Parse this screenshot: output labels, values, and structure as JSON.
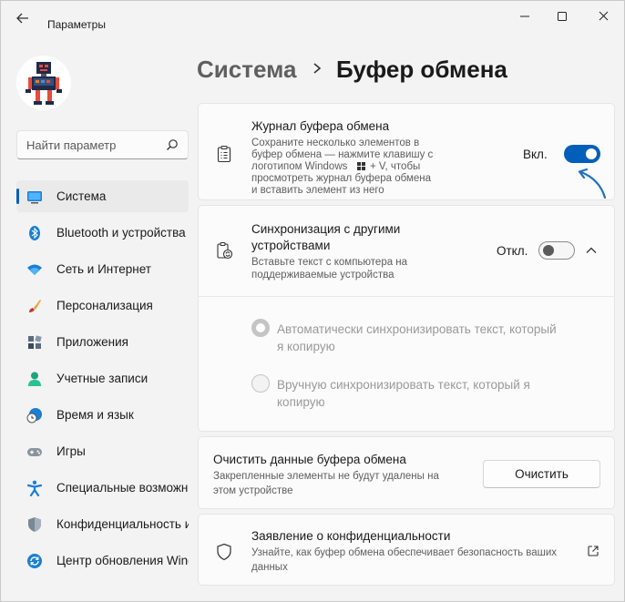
{
  "window": {
    "title": "Параметры"
  },
  "search": {
    "placeholder": "Найти параметр"
  },
  "sidebar": {
    "items": [
      {
        "label": "Система",
        "icon": "system-icon"
      },
      {
        "label": "Bluetooth и устройства",
        "icon": "bluetooth-icon"
      },
      {
        "label": "Сеть и Интернет",
        "icon": "wifi-icon"
      },
      {
        "label": "Персонализация",
        "icon": "brush-icon"
      },
      {
        "label": "Приложения",
        "icon": "apps-icon"
      },
      {
        "label": "Учетные записи",
        "icon": "person-icon"
      },
      {
        "label": "Время и язык",
        "icon": "globe-clock-icon"
      },
      {
        "label": "Игры",
        "icon": "gamepad-icon"
      },
      {
        "label": "Специальные возможности",
        "icon": "accessibility-icon"
      },
      {
        "label": "Конфиденциальность и защита",
        "icon": "shield-icon"
      },
      {
        "label": "Центр обновления Windows",
        "icon": "update-icon"
      }
    ]
  },
  "breadcrumb": {
    "parent": "Система",
    "current": "Буфер обмена"
  },
  "history": {
    "title": "Журнал буфера обмена",
    "desc": [
      "Сохраните несколько элементов в",
      "буфер обмена — нажмите клавишу с",
      "логотипом Windows",
      "+ V, чтобы",
      "просмотреть журнал буфера обмена",
      "и вставить элемент из него"
    ],
    "toggle_label": "Вкл.",
    "toggle_on": true
  },
  "sync": {
    "title": [
      "Синхронизация с другими",
      "устройствами"
    ],
    "desc": [
      "Вставьте текст с компьютера на",
      "поддерживаемые устройства"
    ],
    "toggle_label": "Откл.",
    "toggle_on": false,
    "options": [
      {
        "label": [
          "Автоматически синхронизировать текст, который",
          "я копирую"
        ],
        "checked": true
      },
      {
        "label": [
          "Вручную синхронизировать текст, который я",
          "копирую"
        ],
        "checked": false
      }
    ]
  },
  "clear": {
    "title": "Очистить данные буфера обмена",
    "desc": [
      "Закрепленные элементы не будут удалены на",
      "этом устройстве"
    ],
    "button": "Очистить"
  },
  "privacy": {
    "title": "Заявление о конфиденциальности",
    "desc": [
      "Узнайте, как буфер обмена обеспечивает безопасность ваших",
      "данных"
    ]
  },
  "colors": {
    "accent": "#005fb8",
    "window_bg": "#f3f3f3",
    "card_bg": "#fbfbfb"
  }
}
